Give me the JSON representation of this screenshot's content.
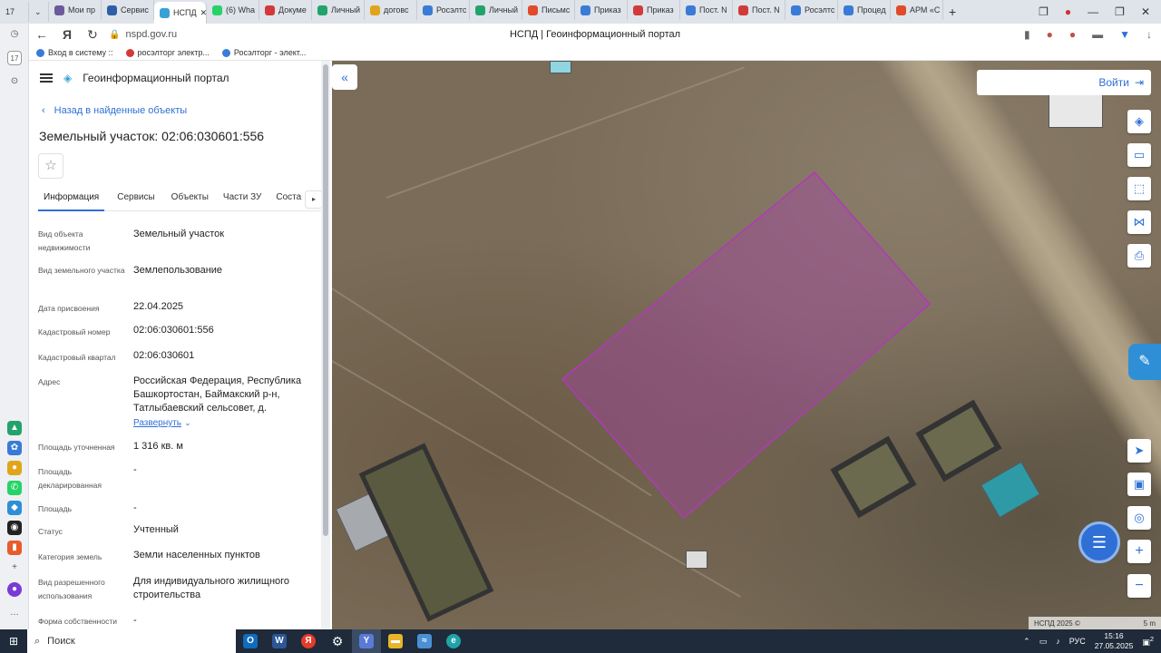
{
  "browser": {
    "tabs": [
      {
        "label": "Мои пр",
        "color": "#6b5a9a"
      },
      {
        "label": "Сервис",
        "color": "#2c5fa8"
      },
      {
        "label": "НСПД",
        "color": "#3aa1d6",
        "active": true
      },
      {
        "label": "(6) Wha",
        "color": "#25d366"
      },
      {
        "label": "Докуме",
        "color": "#d23a3a"
      },
      {
        "label": "Личный",
        "color": "#23a36b"
      },
      {
        "label": "договс",
        "color": "#e0a51a"
      },
      {
        "label": "Росэлтс",
        "color": "#3a7bd5"
      },
      {
        "label": "Личный",
        "color": "#23a36b"
      },
      {
        "label": "Письмс",
        "color": "#e04b2a"
      },
      {
        "label": "Приказ",
        "color": "#3a7bd5"
      },
      {
        "label": "Приказ",
        "color": "#d23a3a"
      },
      {
        "label": "Пост. N",
        "color": "#3a7bd5"
      },
      {
        "label": "Пост. N",
        "color": "#d23a3a"
      },
      {
        "label": "Росэлтс",
        "color": "#3a7bd5"
      },
      {
        "label": "Процед",
        "color": "#3a7bd5"
      },
      {
        "label": "АРМ «С",
        "color": "#e04b2a"
      }
    ],
    "tab_count": "17",
    "url": "nspd.gov.ru",
    "page_title": "НСПД | Геоинформационный портал",
    "bookmarks": [
      "Вход в систему ::",
      "росэлторг электр...",
      "Росэлторг - элект..."
    ]
  },
  "portal": {
    "name": "Геоинформационный портал",
    "back_label": "Назад в найденные объекты",
    "object_title": "Земельный участок: 02:06:030601:556",
    "tabs": [
      "Информация",
      "Сервисы",
      "Объекты",
      "Части ЗУ",
      "Соста"
    ],
    "properties": [
      {
        "key": "Вид объекта недвижимости",
        "value": "Земельный участок"
      },
      {
        "key": "Вид земельного участка",
        "value": "Землепользование"
      },
      {
        "key": "Дата присвоения",
        "value": "22.04.2025"
      },
      {
        "key": "Кадастровый номер",
        "value": "02:06:030601:556"
      },
      {
        "key": "Кадастровый квартал",
        "value": "02:06:030601"
      },
      {
        "key": "Адрес",
        "value": "Российская Федерация, Республика Башкортостан, Баймакский р-н, Татлыбаевский сельсовет, д.",
        "expand": "Развернуть"
      },
      {
        "key": "Площадь уточненная",
        "value": "1 316 кв. м"
      },
      {
        "key": "Площадь декларированная",
        "value": "-"
      },
      {
        "key": "Площадь",
        "value": "-"
      },
      {
        "key": "Статус",
        "value": "Учтенный"
      },
      {
        "key": "Категория земель",
        "value": "Земли населенных пунктов"
      },
      {
        "key": "Вид разрешенного использования",
        "value": "Для индивидуального жилищного строительства"
      },
      {
        "key": "Форма собственности",
        "value": "-"
      }
    ]
  },
  "map": {
    "login_label": "Войти",
    "copyright": "НСПД 2025 ©",
    "scale_label": "5 m",
    "parcel_color": "#b03ab8"
  },
  "taskbar": {
    "search_placeholder": "Поиск",
    "lang": "РУС",
    "time": "15:16",
    "date": "27.05.2025",
    "notifications": "2"
  }
}
